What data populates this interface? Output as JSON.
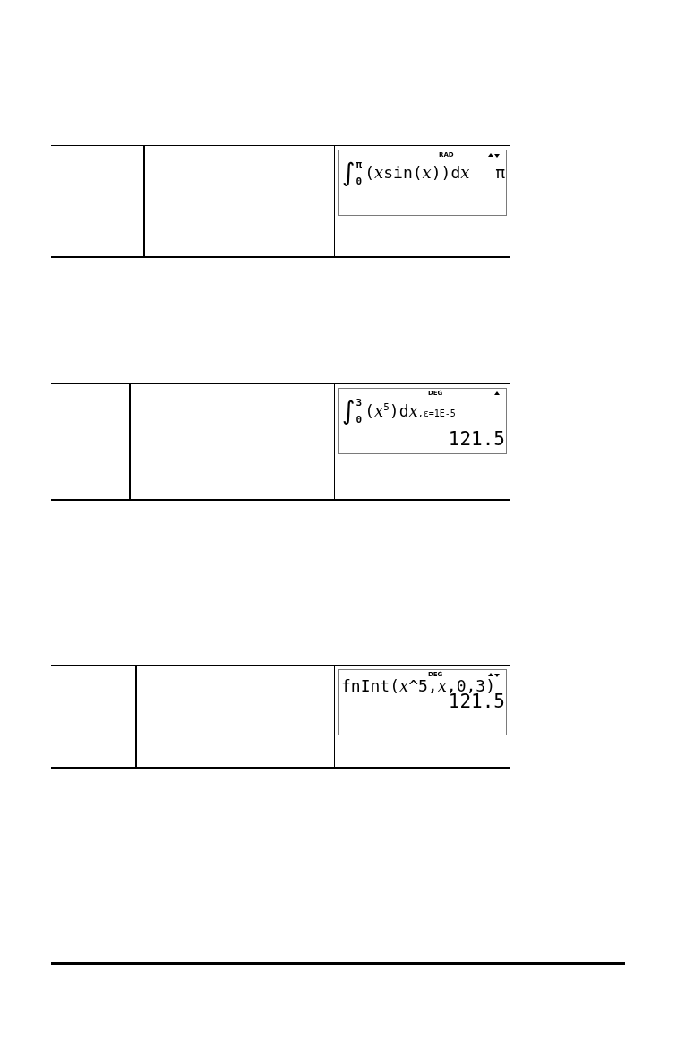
{
  "tables": [
    {
      "screen": {
        "mode": "RAD",
        "scroll_up": true,
        "scroll_down": true,
        "lines": [
          {
            "kind": "integral",
            "sign": "∫",
            "upper": "π",
            "lower": "0",
            "body": [
              {
                "kind": "symbol",
                "text": "("
              },
              {
                "kind": "variable",
                "text": "x"
              },
              {
                "kind": "symbol",
                "text": "sin("
              },
              {
                "kind": "variable",
                "text": "x"
              },
              {
                "kind": "symbol",
                "text": "))d"
              },
              {
                "kind": "variable",
                "text": "x"
              }
            ],
            "result": "π"
          }
        ]
      }
    },
    {
      "screen": {
        "mode": "DEG",
        "scroll_up": true,
        "scroll_down": false,
        "lines": [
          {
            "kind": "integral",
            "sign": "∫",
            "upper": "3",
            "lower": "0",
            "body": [
              {
                "kind": "symbol",
                "text": "("
              },
              {
                "kind": "variable",
                "text": "x"
              },
              {
                "kind": "exponent",
                "text": "5"
              },
              {
                "kind": "symbol",
                "text": ")d"
              },
              {
                "kind": "variable",
                "text": "x"
              }
            ],
            "suffix": ",ε=1E-5"
          },
          {
            "kind": "result",
            "text": "121.5"
          }
        ]
      }
    },
    {
      "screen": {
        "mode": "DEG",
        "scroll_up": true,
        "scroll_down": true,
        "lines": [
          {
            "kind": "expression",
            "body": [
              {
                "kind": "symbol",
                "text": "fnInt("
              },
              {
                "kind": "variable",
                "text": "x"
              },
              {
                "kind": "symbol",
                "text": "^5,"
              },
              {
                "kind": "variable",
                "text": "x"
              },
              {
                "kind": "symbol",
                "text": ",0,3)"
              }
            ]
          },
          {
            "kind": "result",
            "text": "121.5"
          }
        ]
      }
    }
  ]
}
